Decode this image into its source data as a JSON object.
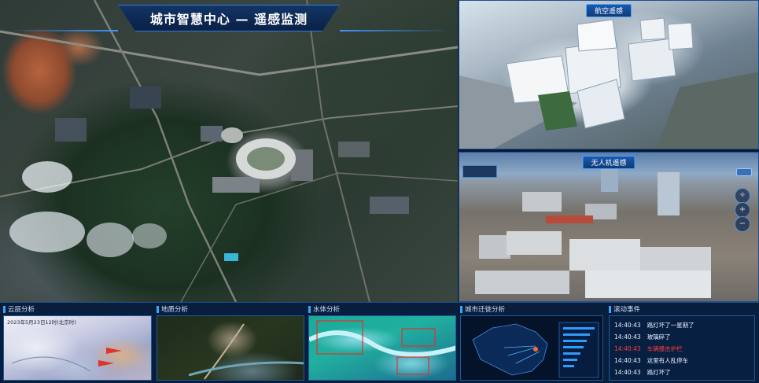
{
  "header": {
    "title": "城市智慧中心 — 遥感监测"
  },
  "panels": {
    "aerial": {
      "label": "航空遥感"
    },
    "drone": {
      "label": "无人机遥感"
    }
  },
  "bottom": {
    "cloud": {
      "title": "云层分析",
      "stamp": "2023年5月23日12时(北京时)"
    },
    "geology": {
      "title": "地质分析"
    },
    "water": {
      "title": "水体分析"
    },
    "migration": {
      "title": "城市迁徙分析"
    },
    "events": {
      "title": "滚动事件",
      "items": [
        {
          "time": "14:40:43",
          "text": "路灯坏了一星期了",
          "alert": false
        },
        {
          "time": "14:40:43",
          "text": "玻璃碎了",
          "alert": false
        },
        {
          "time": "14:40:43",
          "text": "车辆撞击护栏",
          "alert": true
        },
        {
          "time": "14:40:43",
          "text": "这里有人乱停车",
          "alert": false
        },
        {
          "time": "14:40:43",
          "text": "路灯坏了",
          "alert": false
        }
      ]
    }
  },
  "colors": {
    "accent": "#37a6ff",
    "alert": "#ff3d3d",
    "background": "#071a33"
  },
  "icons": {
    "drone_controls": [
      "compass-icon",
      "zoom-in-icon",
      "zoom-out-icon",
      "rotate-icon"
    ]
  }
}
